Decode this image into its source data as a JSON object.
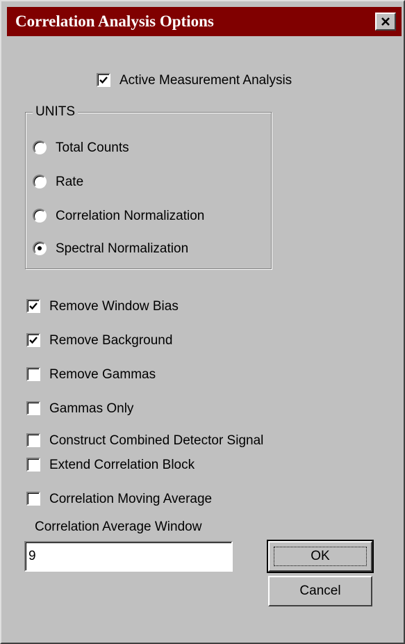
{
  "window": {
    "title": "Correlation Analysis Options",
    "title_bar_color": "#800000",
    "close_icon": "close-icon"
  },
  "active_measurement": {
    "label": "Active Measurement Analysis",
    "checked": true
  },
  "units": {
    "group_label": "UNITS",
    "options": [
      {
        "label": "Total Counts",
        "selected": false
      },
      {
        "label": "Rate",
        "selected": false
      },
      {
        "label": "Correlation Normalization",
        "selected": false
      },
      {
        "label": "Spectral Normalization",
        "selected": true
      }
    ]
  },
  "options": [
    {
      "label": "Remove Window Bias",
      "checked": true
    },
    {
      "label": "Remove Background",
      "checked": true
    },
    {
      "label": "Remove Gammas",
      "checked": false
    },
    {
      "label": "Gammas Only",
      "checked": false
    },
    {
      "label": "Construct Combined Detector Signal",
      "checked": false
    },
    {
      "label": "Extend Correlation Block",
      "checked": false
    },
    {
      "label": "Correlation Moving Average",
      "checked": false
    }
  ],
  "average_window": {
    "label": "Correlation Average Window",
    "value": "9"
  },
  "buttons": {
    "ok_label": "OK",
    "cancel_label": "Cancel"
  }
}
